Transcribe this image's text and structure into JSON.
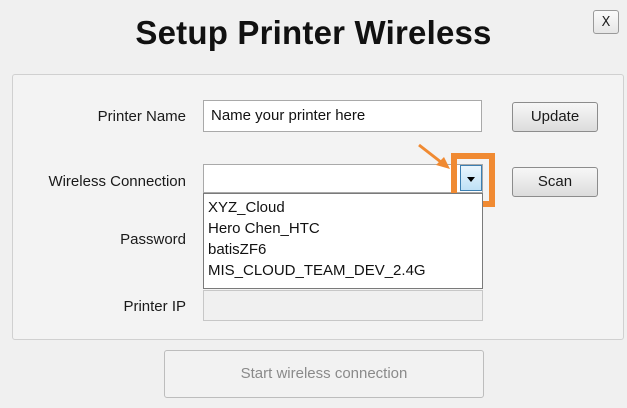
{
  "dialog": {
    "title": "Setup Printer Wireless",
    "close_label": "X"
  },
  "form": {
    "printer_name_label": "Printer Name",
    "printer_name_value": "Name your printer here",
    "update_label": "Update",
    "wireless_label": "Wireless Connection",
    "wireless_value": "",
    "scan_label": "Scan",
    "password_label": "Password",
    "printer_ip_label": "Printer IP",
    "printer_ip_value": ""
  },
  "wifi_options": [
    "XYZ_Cloud",
    "Hero Chen_HTC",
    "batisZF6",
    "MIS_CLOUD_TEAM_DEV_2.4G"
  ],
  "footer": {
    "start_label": "Start wireless connection"
  },
  "colors": {
    "highlight": "#f08a32",
    "dropdown_arrow_border": "#3c7fb1"
  }
}
